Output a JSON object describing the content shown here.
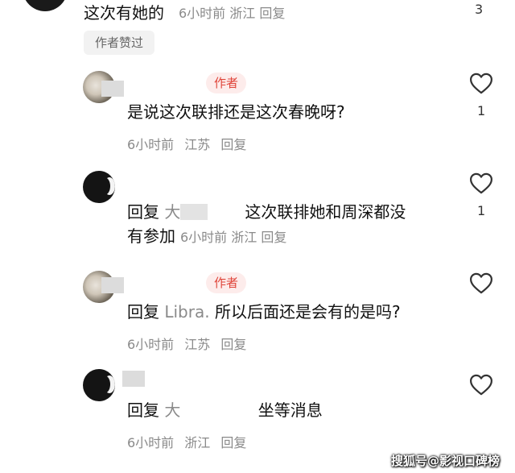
{
  "top_comment": {
    "text": "这次有她的",
    "time": "6小时前",
    "location": "浙江",
    "reply_label": "回复",
    "like_count": "3"
  },
  "liked_badge": "作者赞过",
  "replies": [
    {
      "author_tag": "作者",
      "text": "是说这次联排还是这次春晚呀?",
      "time": "6小时前",
      "location": "江苏",
      "reply_label": "回复",
      "like_count": "1"
    },
    {
      "prefix": "回复",
      "target": "大",
      "text": "这次联排她和周深都没",
      "text2": "有参加",
      "time": "6小时前",
      "location": "浙江",
      "reply_label": "回复",
      "like_count": "1"
    },
    {
      "author_tag": "作者",
      "prefix": "回复",
      "target": "Libra.",
      "text": "所以后面还是会有的是吗?",
      "time": "6小时前",
      "location": "江苏",
      "reply_label": "回复"
    },
    {
      "prefix": "回复",
      "target": "大",
      "text": "坐等消息",
      "time": "6小时前",
      "location": "浙江",
      "reply_label": "回复"
    }
  ],
  "watermark": "搜狐号@影视口碑榜",
  "icons": {
    "like": "heart-outline-icon"
  },
  "colors": {
    "author_tag_bg": "#fdeceb",
    "author_tag_text": "#e0453a",
    "meta": "#8a8a8a"
  }
}
